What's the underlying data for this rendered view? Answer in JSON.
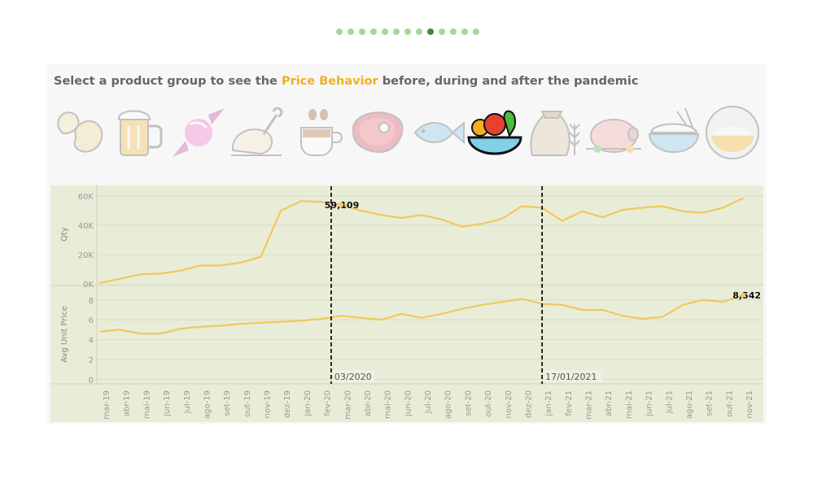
{
  "carousel": {
    "count": 13,
    "active_index": 8
  },
  "header": {
    "prefix": "Select a product group to see the ",
    "highlight": "Price Behavior",
    "suffix": " before, during and after the pandemic"
  },
  "product_icons": [
    {
      "name": "beans-icon",
      "selected": false
    },
    {
      "name": "beer-mug-icon",
      "selected": false
    },
    {
      "name": "candy-icon",
      "selected": false
    },
    {
      "name": "roast-chicken-icon",
      "selected": false
    },
    {
      "name": "coffee-cup-icon",
      "selected": false
    },
    {
      "name": "steak-icon",
      "selected": false
    },
    {
      "name": "fish-icon",
      "selected": false
    },
    {
      "name": "fruit-bowl-icon",
      "selected": true
    },
    {
      "name": "flour-sack-wheat-icon",
      "selected": false
    },
    {
      "name": "roast-pork-icon",
      "selected": false
    },
    {
      "name": "rice-bowl-icon",
      "selected": false
    },
    {
      "name": "sugar-bowl-icon",
      "selected": false
    }
  ],
  "colors": {
    "accent": "#f0b020",
    "line": "#f2c75c",
    "plot_bg": "#e9edd8",
    "dot_active": "#3d8c3a",
    "dot": "#a8d59b"
  },
  "chart_data": {
    "type": "line",
    "categories": [
      "mar-19",
      "abr-19",
      "mai-19",
      "jun-19",
      "jul-19",
      "ago-19",
      "set-19",
      "out-19",
      "nov-19",
      "dez-19",
      "jan-20",
      "fev-20",
      "mar-20",
      "abr-20",
      "mai-20",
      "jun-20",
      "jul-20",
      "ago-20",
      "set-20",
      "out-20",
      "nov-20",
      "dez-20",
      "jan-21",
      "fev-21",
      "mar-21",
      "abr-21",
      "mai-21",
      "jun-21",
      "jul-21",
      "ago-21",
      "set-21",
      "out-21",
      "nov-21"
    ],
    "series": [
      {
        "name": "Qty",
        "ylim": [
          0,
          65000
        ],
        "ticks": [
          {
            "v": 0,
            "label": "0K"
          },
          {
            "v": 20000,
            "label": "20K"
          },
          {
            "v": 40000,
            "label": "40K"
          },
          {
            "v": 60000,
            "label": "60K"
          }
        ],
        "values": [
          500,
          3500,
          6500,
          7000,
          9000,
          12500,
          12500,
          14500,
          18500,
          50000,
          56500,
          56000,
          54000,
          50000,
          47000,
          45000,
          47000,
          44000,
          39000,
          41000,
          44500,
          53000,
          52000,
          43000,
          49500,
          45500,
          50500,
          52000,
          53000,
          49500,
          48500,
          52000,
          58500
        ],
        "annotation": {
          "index": 12,
          "text": "59,109",
          "anchor": "end"
        }
      },
      {
        "name": "Avg Unit Price",
        "ylim": [
          -0.3,
          9.3
        ],
        "ticks": [
          {
            "v": 0,
            "label": "0"
          },
          {
            "v": 2,
            "label": "2"
          },
          {
            "v": 4,
            "label": "4"
          },
          {
            "v": 6,
            "label": "6"
          },
          {
            "v": 8,
            "label": "8"
          }
        ],
        "values": [
          4.8,
          5.0,
          4.6,
          4.6,
          5.1,
          5.3,
          5.4,
          5.6,
          5.7,
          5.8,
          5.9,
          6.1,
          6.4,
          6.2,
          6.0,
          6.6,
          6.2,
          6.6,
          7.1,
          7.5,
          7.8,
          8.1,
          7.6,
          7.5,
          7.0,
          7.0,
          6.4,
          6.1,
          6.3,
          7.5,
          8.0,
          7.8,
          8.5
        ],
        "annotation": {
          "index": 32,
          "text": "8,542",
          "anchor": "end"
        }
      }
    ],
    "events": [
      {
        "position": 11.5,
        "label": "03/2020"
      },
      {
        "position": 22.0,
        "label": "17/01/2021"
      }
    ]
  }
}
